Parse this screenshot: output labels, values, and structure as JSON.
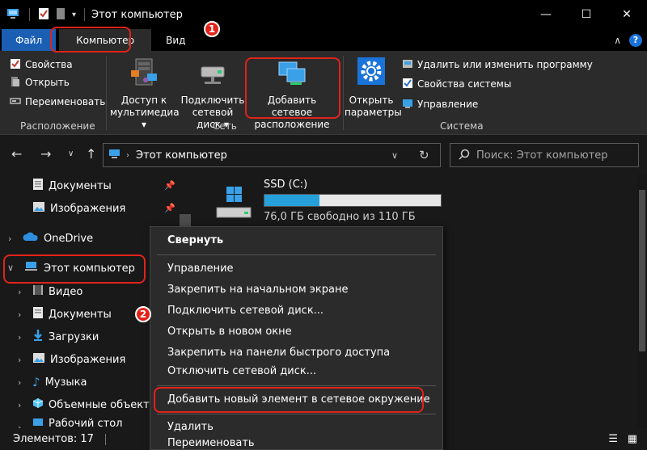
{
  "window": {
    "title": "Этот компьютер"
  },
  "tabs": {
    "file": "Файл",
    "computer": "Компьютер",
    "view": "Вид"
  },
  "ribbon": {
    "location_group": {
      "label": "Расположение",
      "properties": "Свойства",
      "open": "Открыть",
      "rename": "Переименовать"
    },
    "network_group": {
      "label": "Сеть",
      "media_access_line1": "Доступ к",
      "media_access_line2": "мультимедиа",
      "map_drive_line1": "Подключить",
      "map_drive_line2": "сетевой диск",
      "add_location_line1": "Добавить сетевое",
      "add_location_line2": "расположение"
    },
    "system_group": {
      "label": "Система",
      "open_settings_line1": "Открыть",
      "open_settings_line2": "параметры",
      "uninstall": "Удалить или изменить программу",
      "system_properties": "Свойства системы",
      "manage": "Управление"
    }
  },
  "address": {
    "path": "Этот компьютер",
    "search_placeholder": "Поиск: Этот компьютер"
  },
  "navpane": {
    "items": [
      {
        "label": "Документы"
      },
      {
        "label": "Изображения"
      },
      {
        "label": "OneDrive"
      },
      {
        "label": "Этот компьютер"
      },
      {
        "label": "Видео"
      },
      {
        "label": "Документы"
      },
      {
        "label": "Загрузки"
      },
      {
        "label": "Изображения"
      },
      {
        "label": "Музыка"
      },
      {
        "label": "Объемные объекты"
      },
      {
        "label": "Рабочий стол"
      }
    ]
  },
  "drive": {
    "name": "SSD (C:)",
    "free_text": "76,0 ГБ свободно из 110 ГБ",
    "used_fraction": 0.31
  },
  "status": {
    "items_count": "Элементов: 17"
  },
  "context_menu": {
    "collapse": "Свернуть",
    "manage": "Управление",
    "pin_start": "Закрепить на начальном экране",
    "map_drive": "Подключить сетевой диск...",
    "open_new_window": "Открыть в новом окне",
    "pin_quick_access": "Закрепить на панели быстрого доступа",
    "disconnect_drive": "Отключить сетевой диск...",
    "add_network_location": "Добавить новый элемент в сетевое окружение",
    "delete": "Удалить",
    "rename": "Переименовать"
  },
  "annotations": {
    "step1": "1",
    "step2": "2"
  },
  "colors": {
    "accent": "#1a5fb4",
    "highlight": "#e2231a",
    "drive_fill": "#26a0da"
  }
}
